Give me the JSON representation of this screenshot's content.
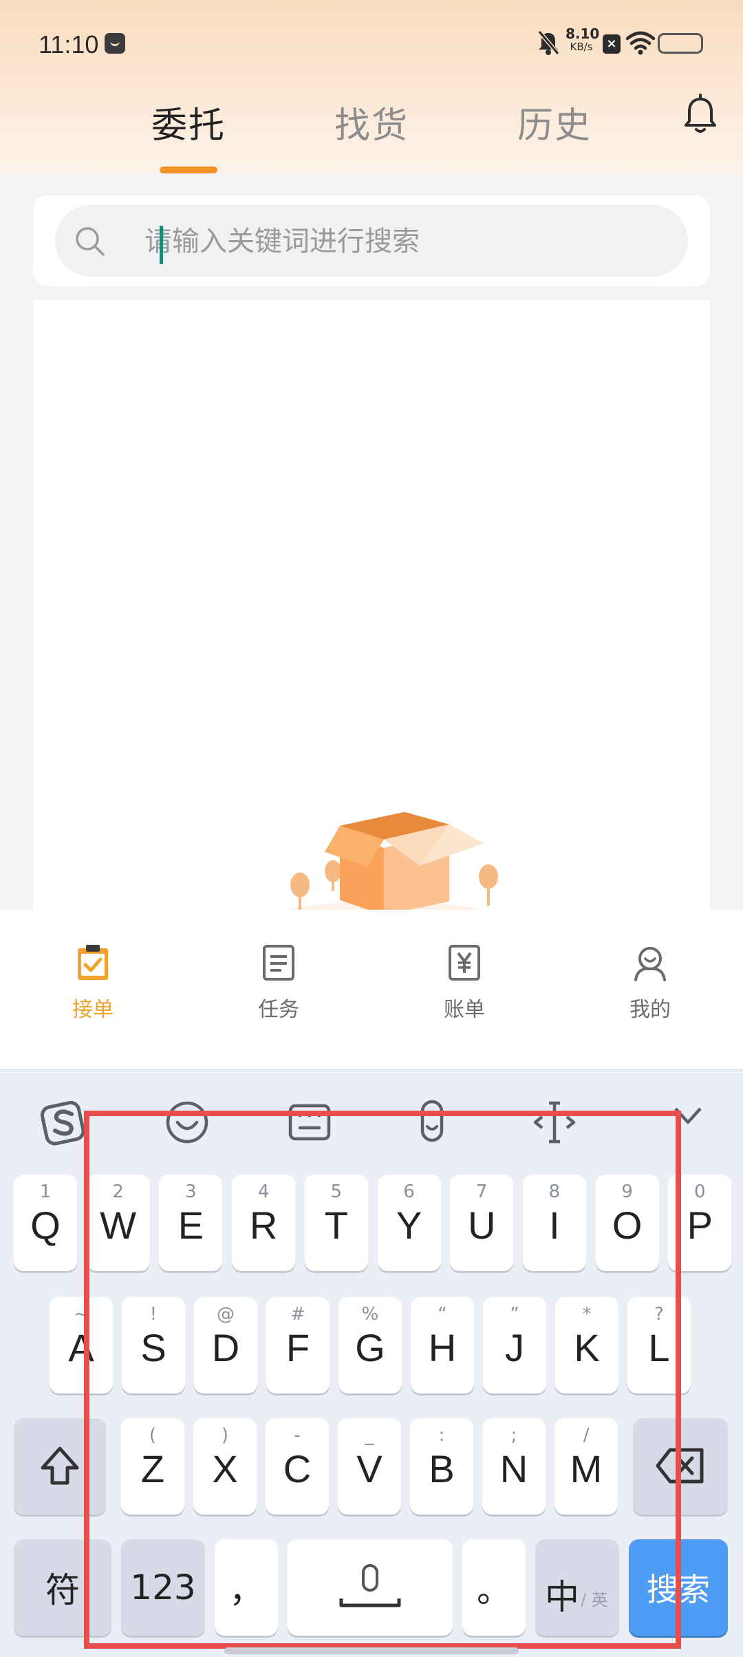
{
  "status_bar": {
    "time": "11:10",
    "net_speed_value": "8.10",
    "net_speed_unit": "KB/s",
    "sim_label": "×"
  },
  "tabs": [
    {
      "label": "委托",
      "active": true
    },
    {
      "label": "找货",
      "active": false
    },
    {
      "label": "历史",
      "active": false
    }
  ],
  "search": {
    "placeholder": "请输入关键词进行搜索",
    "value": ""
  },
  "bottom_nav": [
    {
      "label": "接单",
      "icon": "clipboard-check-icon",
      "active": true
    },
    {
      "label": "任务",
      "icon": "document-icon",
      "active": false
    },
    {
      "label": "账单",
      "icon": "yen-bill-icon",
      "active": false
    },
    {
      "label": "我的",
      "icon": "user-icon",
      "active": false
    }
  ],
  "keyboard": {
    "toolbar": [
      "sogou-logo-icon",
      "emoji-icon",
      "keyboard-layout-icon",
      "voice-icon",
      "cursor-icon",
      "collapse-icon"
    ],
    "row1": [
      {
        "hint": "1",
        "key": "Q"
      },
      {
        "hint": "2",
        "key": "W"
      },
      {
        "hint": "3",
        "key": "E"
      },
      {
        "hint": "4",
        "key": "R"
      },
      {
        "hint": "5",
        "key": "T"
      },
      {
        "hint": "6",
        "key": "Y"
      },
      {
        "hint": "7",
        "key": "U"
      },
      {
        "hint": "8",
        "key": "I"
      },
      {
        "hint": "9",
        "key": "O"
      },
      {
        "hint": "0",
        "key": "P"
      }
    ],
    "row2": [
      {
        "hint": "~",
        "key": "A"
      },
      {
        "hint": "!",
        "key": "S"
      },
      {
        "hint": "@",
        "key": "D"
      },
      {
        "hint": "#",
        "key": "F"
      },
      {
        "hint": "%",
        "key": "G"
      },
      {
        "hint": "“",
        "key": "H"
      },
      {
        "hint": "”",
        "key": "J"
      },
      {
        "hint": "*",
        "key": "K"
      },
      {
        "hint": "?",
        "key": "L"
      }
    ],
    "row3": [
      {
        "hint": "(",
        "key": "Z"
      },
      {
        "hint": ")",
        "key": "X"
      },
      {
        "hint": "-",
        "key": "C"
      },
      {
        "hint": "_",
        "key": "V"
      },
      {
        "hint": ":",
        "key": "B"
      },
      {
        "hint": ";",
        "key": "N"
      },
      {
        "hint": "/",
        "key": "M"
      }
    ],
    "bottom": {
      "symbols": "符",
      "numbers": "123",
      "comma": "，",
      "period": "。",
      "lang_main": "中",
      "lang_alt": "/ 英",
      "enter": "搜索"
    }
  },
  "colors": {
    "accent": "#f29227",
    "nav_active": "#f0a22f",
    "enter_key": "#4f9cf5",
    "highlight_frame": "#e84f4c"
  }
}
